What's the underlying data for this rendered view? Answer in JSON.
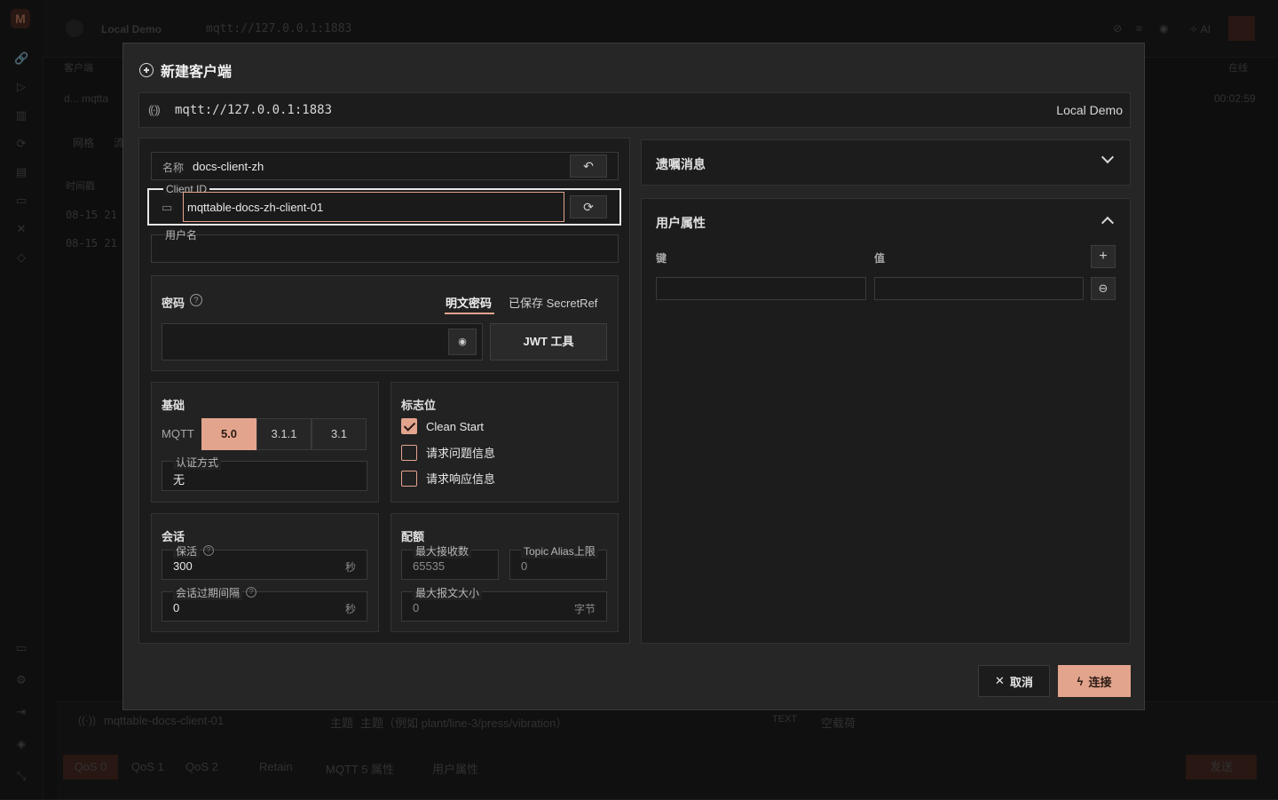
{
  "background": {
    "logo": "M",
    "connection_name": "Local Demo",
    "connection_url": "mqtt://127.0.0.1:1883",
    "clients_label": "客户端",
    "online_label": "在线",
    "client_row": "d... mqtta",
    "timer": "00:02:59",
    "tab_grid": "网格",
    "tab_second": "流",
    "time_col": "时间戳",
    "time_row_1": "08-15 21",
    "time_row_2": "08-15 21",
    "ai_label": "AI",
    "bottom_client": "mqttable-docs-client-01",
    "topic_label": "主题",
    "topic_placeholder": "主题（例如 plant/line-3/press/vibration）",
    "payload_format": "TEXT",
    "payload_placeholder": "空载荷",
    "qos0": "QoS 0",
    "qos1": "QoS 1",
    "qos2": "QoS 2",
    "retain": "Retain",
    "mqtt5_props": "MQTT 5 属性",
    "user_props": "用户属性",
    "send": "发送"
  },
  "modal": {
    "title": "新建客户端",
    "url": "mqtt://127.0.0.1:1883",
    "connection_name": "Local Demo",
    "name_label": "名称",
    "name_value": "docs-client-zh",
    "client_id_label": "Client ID",
    "client_id_value": "mqttable-docs-zh-client-01",
    "username_label": "用户名",
    "password_label": "密码",
    "password_tab_plain": "明文密码",
    "password_tab_saved": "已保存 SecretRef",
    "jwt_button": "JWT 工具",
    "basics_title": "基础",
    "mqtt_label": "MQTT",
    "mqtt_versions": [
      "5.0",
      "3.1.1",
      "3.1"
    ],
    "mqtt_selected": "5.0",
    "auth_label": "认证方式",
    "auth_value": "无",
    "flags_title": "标志位",
    "flags": [
      {
        "label": "Clean Start",
        "checked": true
      },
      {
        "label": "请求问题信息",
        "checked": false
      },
      {
        "label": "请求响应信息",
        "checked": false
      }
    ],
    "session_title": "会话",
    "keepalive_label": "保活",
    "keepalive_value": "300",
    "keepalive_unit": "秒",
    "expiry_label": "会话过期间隔",
    "expiry_value": "0",
    "expiry_unit": "秒",
    "quota_title": "配额",
    "receive_max_label": "最大接收数",
    "receive_max_value": "65535",
    "topic_alias_label": "Topic Alias上限",
    "topic_alias_value": "0",
    "max_packet_label": "最大报文大小",
    "max_packet_value": "0",
    "max_packet_unit": "字节",
    "will_title": "遗嘱消息",
    "user_props_title": "用户属性",
    "key_label": "键",
    "value_label": "值",
    "cancel": "取消",
    "connect": "连接"
  },
  "colors": {
    "accent": "#e3a48d",
    "background": "#1a1a1a",
    "panel": "#1c1c1c"
  }
}
